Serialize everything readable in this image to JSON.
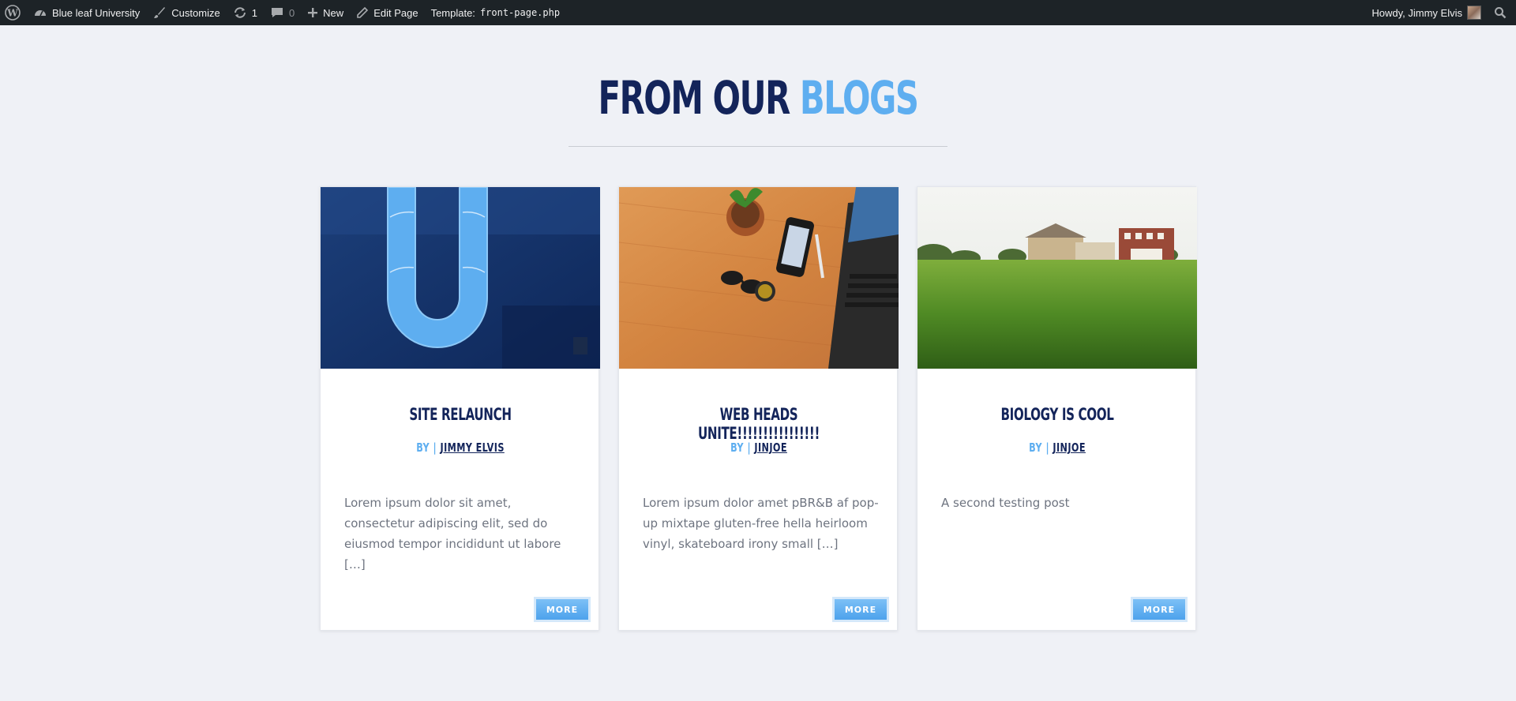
{
  "adminbar": {
    "site_name": "Blue leaf University",
    "customize": "Customize",
    "updates_count": "1",
    "comments_count": "0",
    "new_label": "New",
    "edit_page": "Edit Page",
    "template_label": "Template:",
    "template_file": "front-page.php",
    "greeting": "Howdy, Jimmy Elvis"
  },
  "section": {
    "heading_dark": "FROM OUR",
    "heading_light": "BLOGS"
  },
  "posts": [
    {
      "title": "SITE RELAUNCH",
      "by": "BY",
      "separator": "|",
      "author": "JIMMY ELVIS",
      "excerpt": "Lorem ipsum dolor sit amet, consectetur adipiscing elit, sed do eiusmod tempor incididunt ut labore […]",
      "more": "MORE"
    },
    {
      "title": "WEB HEADS UNITE!!!!!!!!!!!!!!!!",
      "by": "BY",
      "separator": "|",
      "author": "JINJOE",
      "excerpt": "Lorem ipsum dolor amet pBR&B af pop-up mixtape gluten-free hella heirloom vinyl, skateboard irony small […]",
      "more": "MORE"
    },
    {
      "title": "BIOLOGY IS COOL",
      "by": "BY",
      "separator": "|",
      "author": "JINJOE",
      "excerpt": "A second testing post",
      "more": "MORE"
    }
  ],
  "colors": {
    "dark_navy": "#13245a",
    "light_blue": "#5eaef0",
    "adminbar": "#1d2327",
    "page_bg": "#eff1f6"
  },
  "icons": [
    "wordpress-icon",
    "dashboard-icon",
    "brush-icon",
    "refresh-icon",
    "comment-icon",
    "plus-icon",
    "pencil-icon",
    "search-icon"
  ]
}
